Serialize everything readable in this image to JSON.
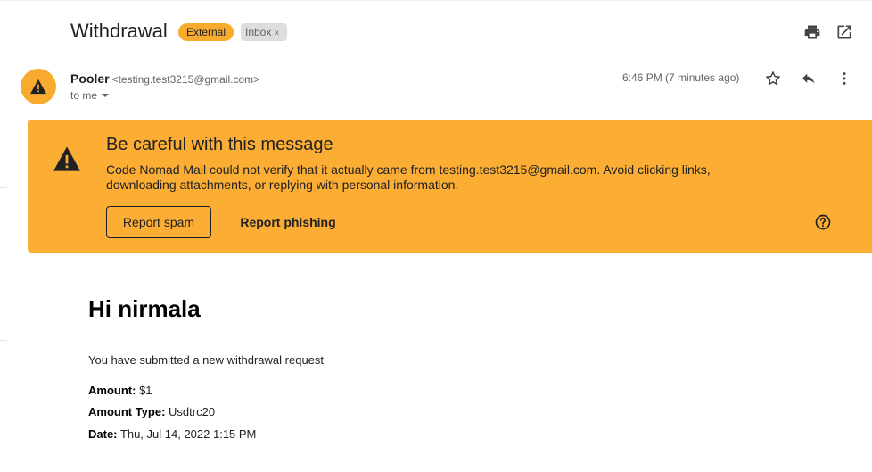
{
  "email": {
    "subject": "Withdrawal",
    "labels": {
      "external": "External",
      "inbox": "Inbox",
      "inbox_remove": "×"
    },
    "sender": {
      "name": "Pooler",
      "email": "<testing.test3215@gmail.com>"
    },
    "recipient": "to me",
    "timestamp": "6:46 PM (7 minutes ago)"
  },
  "warning": {
    "title": "Be careful with this message",
    "text": "Code Nomad Mail could not verify that it actually came from testing.test3215@gmail.com. Avoid clicking links, downloading attachments, or replying with personal information.",
    "report_spam": "Report spam",
    "report_phishing": "Report phishing"
  },
  "body": {
    "greeting": "Hi nirmala",
    "intro": "You have submitted a new withdrawal request",
    "amount_label": "Amount:",
    "amount_value": "$1",
    "type_label": "Amount Type:",
    "type_value": "Usdtrc20",
    "date_label": "Date:",
    "date_value": "Thu, Jul 14, 2022 1:15 PM"
  },
  "colors": {
    "warning": "#fcad33",
    "chip_external": "#f9ab2f",
    "chip_inbox": "#dddddd"
  },
  "icons": [
    "print-icon",
    "open-in-new-window-icon",
    "warning-icon",
    "star-icon",
    "reply-icon",
    "more-vert-icon",
    "help-icon",
    "chevron-down-icon"
  ]
}
